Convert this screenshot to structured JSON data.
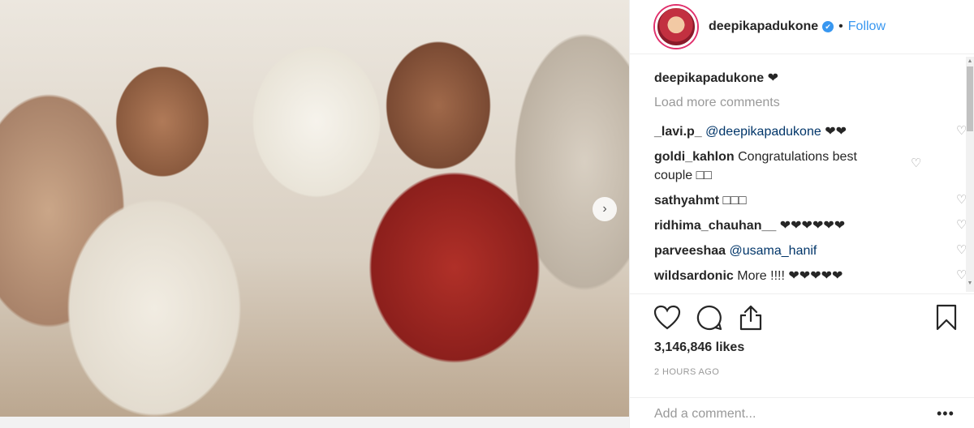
{
  "post": {
    "image_alt": "Wedding photo",
    "next_arrow": "›"
  },
  "header": {
    "username": "deepikapadukone",
    "verified_glyph": "✔",
    "separator": "•",
    "follow_label": "Follow"
  },
  "caption": {
    "username": "deepikapadukone",
    "text": "❤"
  },
  "load_more_label": "Load more comments",
  "comments": [
    {
      "username": "_lavi.p_",
      "mention": "@deepikapadukone",
      "text": "❤❤"
    },
    {
      "username": "goldi_kahlon",
      "mention": "",
      "text": "Congratulations best couple □□"
    },
    {
      "username": "sathyahmt",
      "mention": "",
      "text": "□□□"
    },
    {
      "username": "ridhima_chauhan__",
      "mention": "",
      "text": "❤❤❤❤❤❤"
    },
    {
      "username": "parveeshaa",
      "mention": "@usama_hanif",
      "text": ""
    },
    {
      "username": "wildsardonic",
      "mention": "",
      "text": "More !!!! ❤❤❤❤❤"
    }
  ],
  "likes": "3,146,846 likes",
  "timestamp": "2 HOURS AGO",
  "add_comment_placeholder": "Add a comment...",
  "more_options": "•••",
  "colors": {
    "link": "#3897f0",
    "mention": "#003569",
    "muted": "#999999",
    "text": "#262626"
  }
}
